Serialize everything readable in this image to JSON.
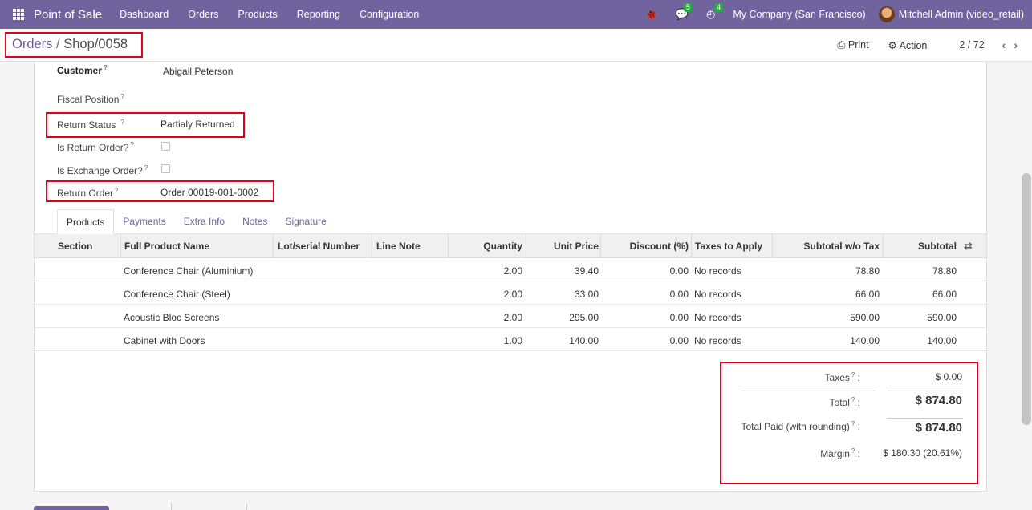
{
  "navbar": {
    "app_name": "Point of Sale",
    "menus": [
      "Dashboard",
      "Orders",
      "Products",
      "Reporting",
      "Configuration"
    ],
    "chat_badge": "5",
    "activity_badge": "4",
    "company": "My Company (San Francisco)",
    "user": "Mitchell Admin (video_retail)",
    "accent_color": "#71639e"
  },
  "control": {
    "breadcrumb_parent": "Orders",
    "breadcrumb_sep": "/",
    "breadcrumb_current": "Shop/0058",
    "print_label": "Print",
    "action_label": "Action",
    "pager": "2 / 72"
  },
  "form": {
    "customer_label": "Customer",
    "customer_value": "Abigail Peterson",
    "fiscal_label": "Fiscal Position",
    "return_status_label": "Return Status",
    "return_status_value": "Partialy Returned",
    "is_return_label": "Is Return Order?",
    "is_exchange_label": "Is Exchange Order?",
    "return_order_label": "Return Order",
    "return_order_value": "Order 00019-001-0002",
    "help_mark": "?"
  },
  "tabs": [
    "Products",
    "Payments",
    "Extra Info",
    "Notes",
    "Signature"
  ],
  "table": {
    "headers": {
      "section": "Section",
      "product": "Full Product Name",
      "lot": "Lot/serial Number",
      "note": "Line Note",
      "qty": "Quantity",
      "price": "Unit Price",
      "discount": "Discount (%)",
      "taxes": "Taxes to Apply",
      "subtotal_wo": "Subtotal w/o Tax",
      "subtotal": "Subtotal"
    },
    "rows": [
      {
        "product": "Conference Chair (Aluminium)",
        "qty": "2.00",
        "price": "39.40",
        "discount": "0.00",
        "taxes": "No records",
        "subtotal_wo": "78.80",
        "subtotal": "78.80"
      },
      {
        "product": "Conference Chair (Steel)",
        "qty": "2.00",
        "price": "33.00",
        "discount": "0.00",
        "taxes": "No records",
        "subtotal_wo": "66.00",
        "subtotal": "66.00"
      },
      {
        "product": "Acoustic Bloc Screens",
        "qty": "2.00",
        "price": "295.00",
        "discount": "0.00",
        "taxes": "No records",
        "subtotal_wo": "590.00",
        "subtotal": "590.00"
      },
      {
        "product": "Cabinet with Doors",
        "qty": "1.00",
        "price": "140.00",
        "discount": "0.00",
        "taxes": "No records",
        "subtotal_wo": "140.00",
        "subtotal": "140.00"
      }
    ]
  },
  "totals": {
    "taxes_label": "Taxes",
    "taxes_value": "$ 0.00",
    "total_label": "Total",
    "total_value": "$ 874.80",
    "paid_label": "Total Paid (with rounding)",
    "paid_value": "$ 874.80",
    "margin_label": "Margin",
    "margin_value": "$ 180.30 (20.61%)"
  }
}
